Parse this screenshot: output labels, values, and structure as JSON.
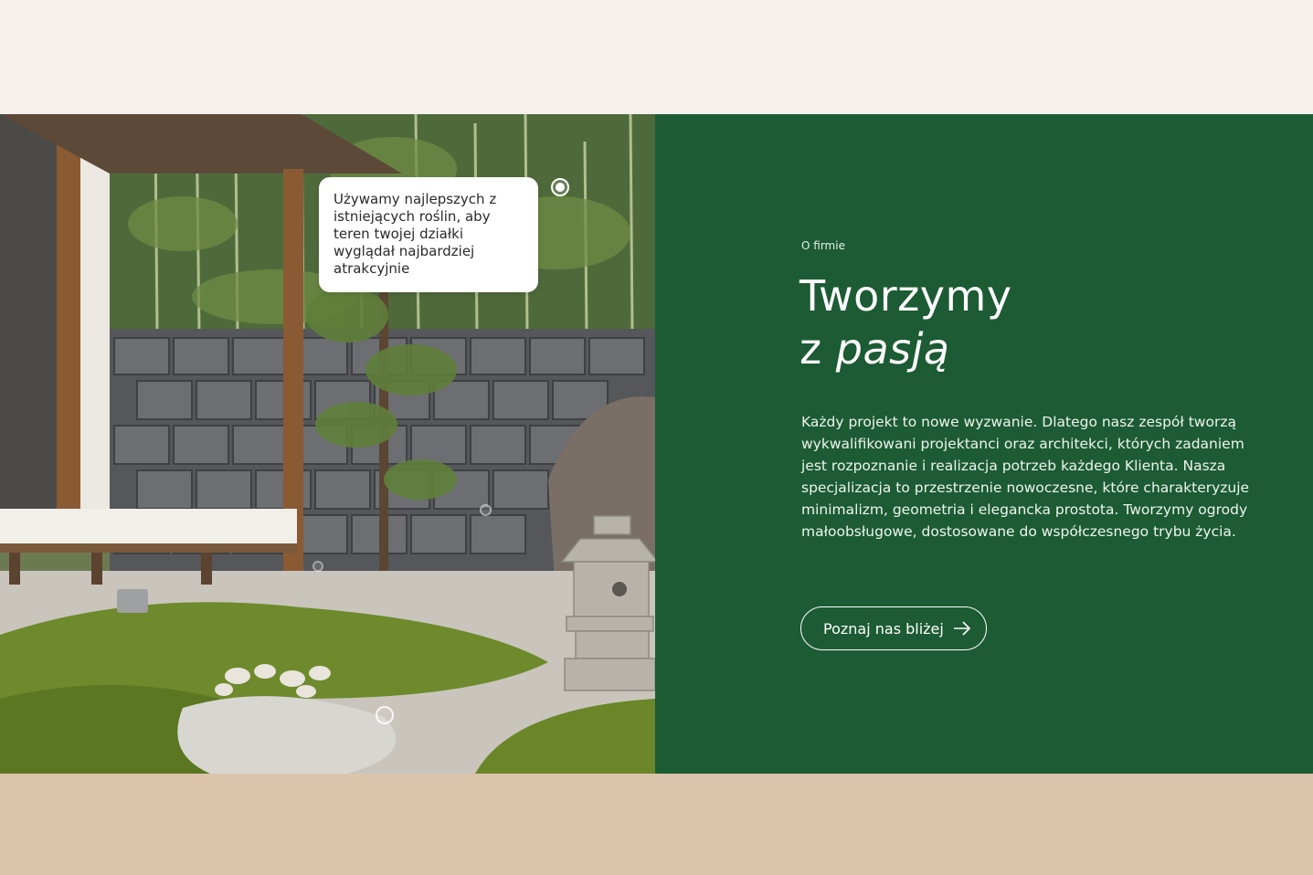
{
  "hero": {
    "tooltip_text": "Używamy najlepszych z istniejących roślin, aby teren twojej działki wyglądał najbardziej atrakcyjnie",
    "photo_icon": "garden-photo-icon"
  },
  "about": {
    "eyebrow": "O firmie",
    "title_line1": "Tworzymy",
    "title_line2_prefix": "z ",
    "title_line2_emphasis": "pasją",
    "description": "Każdy projekt to nowe wyzwanie. Dlatego nasz zespół tworzą wykwalifikowani projektanci oraz architekci, których zadaniem jest rozpoznanie i realizacja potrzeb każdego Klienta. Nasza specjalizacja to przestrzenie nowoczesne, które charakteryzuje minimalizm, geometria i elegancka prostota. Tworzymy ogrody małoobsługowe, dostosowane do współczesnego trybu życia.",
    "cta_label": "Poznaj nas bliżej",
    "cta_icon": "arrow-right-icon"
  },
  "colors": {
    "panel_green": "#1c5b33",
    "top_background": "#f5f0ec",
    "bottom_band": "#dcc3ab"
  }
}
